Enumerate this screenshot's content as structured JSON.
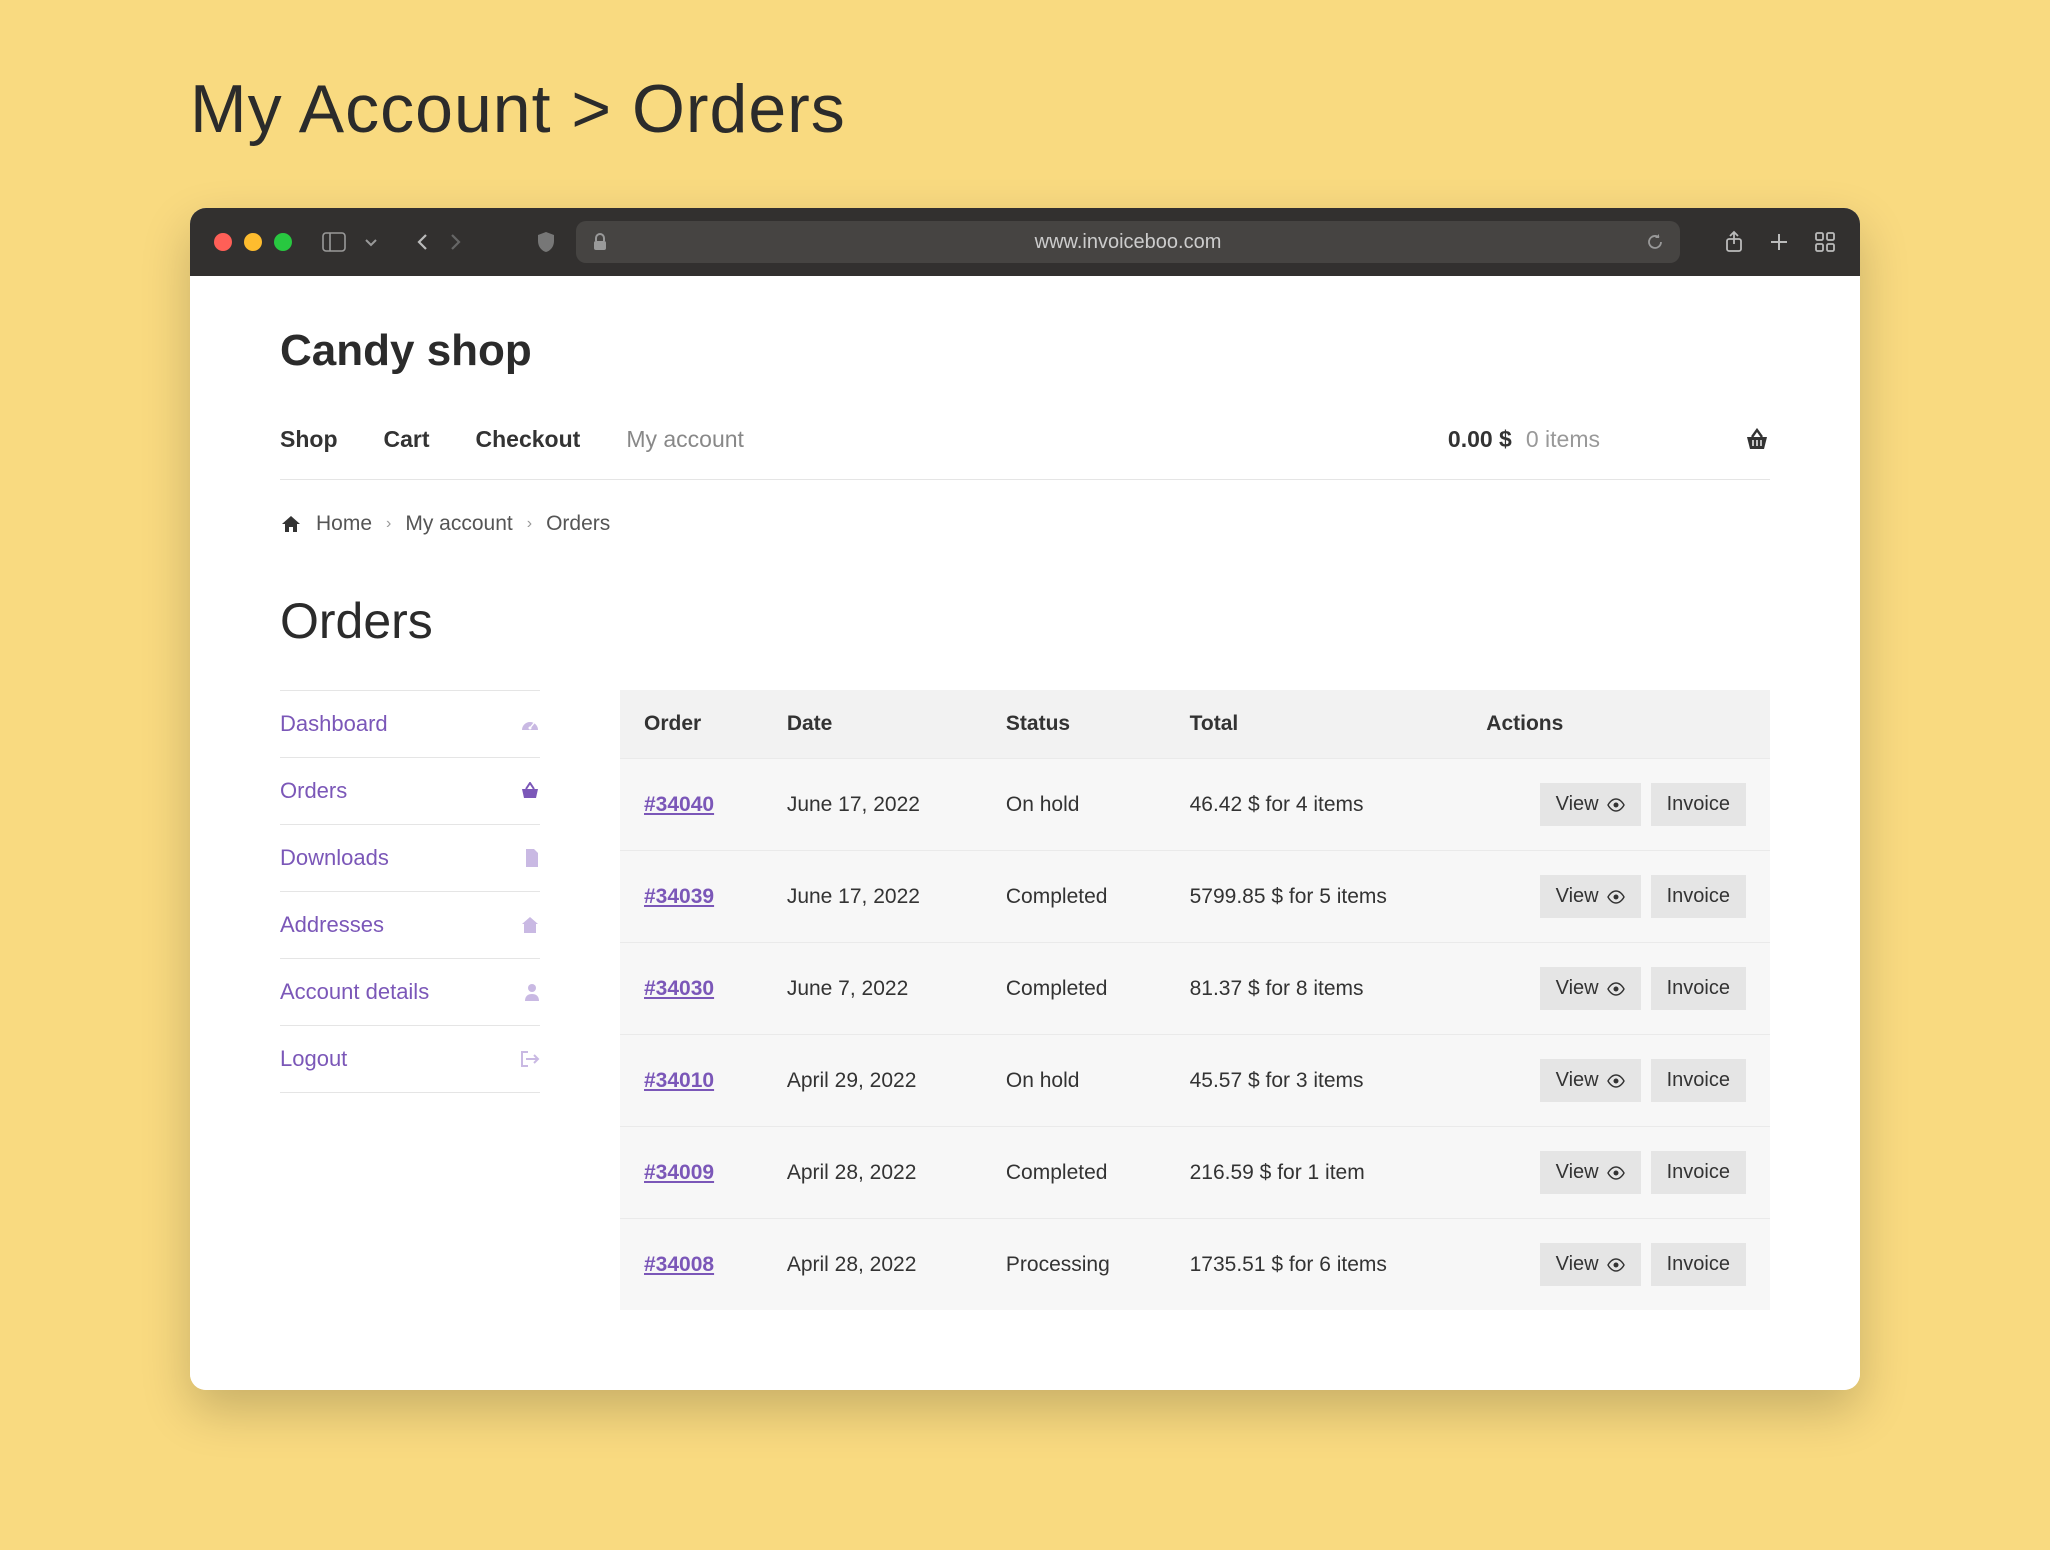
{
  "outer_title": "My Account > Orders",
  "browser": {
    "url": "www.invoiceboo.com"
  },
  "site_title": "Candy shop",
  "nav": {
    "shop": "Shop",
    "cart": "Cart",
    "checkout": "Checkout",
    "my_account": "My account"
  },
  "cart": {
    "amount": "0.00 $",
    "items": "0 items"
  },
  "breadcrumb": {
    "home": "Home",
    "my_account": "My account",
    "orders": "Orders"
  },
  "page_heading": "Orders",
  "sidebar": {
    "dashboard": "Dashboard",
    "orders": "Orders",
    "downloads": "Downloads",
    "addresses": "Addresses",
    "account_details": "Account details",
    "logout": "Logout"
  },
  "table": {
    "headers": {
      "order": "Order",
      "date": "Date",
      "status": "Status",
      "total": "Total",
      "actions": "Actions"
    },
    "rows": [
      {
        "order": "#34040",
        "date": "June 17, 2022",
        "status": "On hold",
        "total": "46.42 $ for 4 items"
      },
      {
        "order": "#34039",
        "date": "June 17, 2022",
        "status": "Completed",
        "total": "5799.85 $ for 5 items"
      },
      {
        "order": "#34030",
        "date": "June 7, 2022",
        "status": "Completed",
        "total": "81.37 $ for 8 items"
      },
      {
        "order": "#34010",
        "date": "April 29, 2022",
        "status": "On hold",
        "total": "45.57 $ for 3 items"
      },
      {
        "order": "#34009",
        "date": "April 28, 2022",
        "status": "Completed",
        "total": "216.59 $ for 1 item"
      },
      {
        "order": "#34008",
        "date": "April 28, 2022",
        "status": "Processing",
        "total": "1735.51 $ for 6 items"
      }
    ]
  },
  "buttons": {
    "view": "View",
    "invoice": "Invoice"
  }
}
